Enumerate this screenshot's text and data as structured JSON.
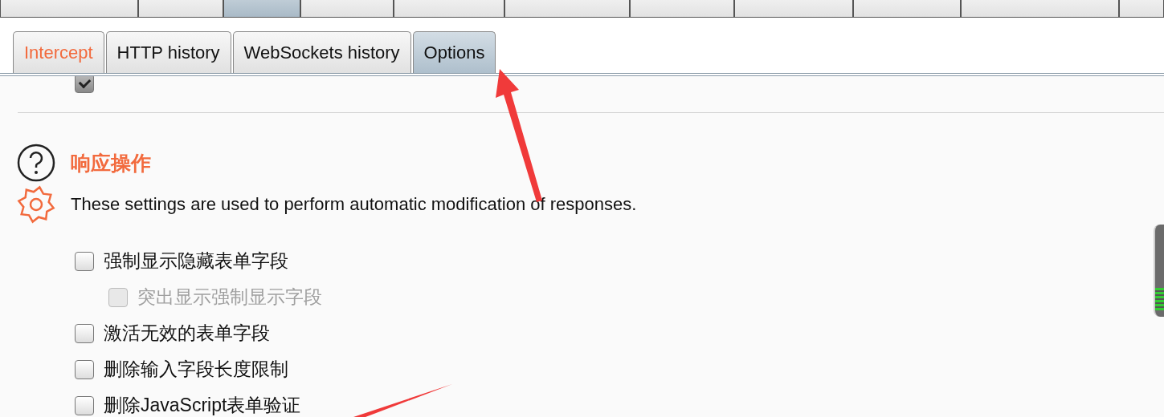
{
  "top_tabs": [
    {
      "selected": false
    },
    {
      "selected": false
    },
    {
      "selected": true
    },
    {
      "selected": false
    },
    {
      "selected": false
    },
    {
      "selected": false
    },
    {
      "selected": false
    },
    {
      "selected": false
    },
    {
      "selected": false
    },
    {
      "selected": false
    },
    {
      "selected": false
    }
  ],
  "sub_tabs": [
    {
      "label": "Intercept",
      "selected": false,
      "kind": "highlight"
    },
    {
      "label": "HTTP history",
      "selected": false,
      "kind": "plain"
    },
    {
      "label": "WebSockets history",
      "selected": false,
      "kind": "plain"
    },
    {
      "label": "Options",
      "selected": true,
      "kind": "plain"
    }
  ],
  "previous_option": {
    "checked": true,
    "disabled": false
  },
  "section": {
    "title": "响应操作",
    "description": "These settings are used to perform automatic modification of responses.",
    "options": [
      {
        "label": "强制显示隐藏表单字段",
        "checked": false,
        "disabled": false,
        "children": [
          {
            "label": "突出显示强制显示字段",
            "checked": false,
            "disabled": true
          }
        ]
      },
      {
        "label": "激活无效的表单字段",
        "checked": false,
        "disabled": false
      },
      {
        "label": "删除输入字段长度限制",
        "checked": false,
        "disabled": false
      },
      {
        "label": "删除JavaScript表单验证",
        "checked": false,
        "disabled": false
      }
    ]
  }
}
